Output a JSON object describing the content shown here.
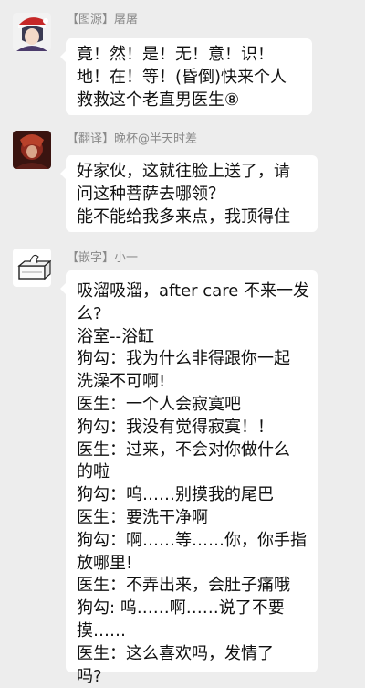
{
  "messages": [
    {
      "sender": "【图源】屠屠",
      "avatar_icon": "anime-boy-santa-hat-avatar",
      "lines": [
        "竟！然！是！无！意！识！",
        "地！在！等！(昏倒)快来个人",
        "救救这个老直男医生⑧"
      ]
    },
    {
      "sender": "【翻译】晚杯@半天时差",
      "avatar_icon": "dark-red-character-avatar",
      "lines": [
        "好家伙，这就往脸上送了，请",
        "问这种菩萨去哪领？",
        "能不能给我多来点，我顶得住"
      ]
    },
    {
      "sender": "【嵌字】小一",
      "avatar_icon": "tissue-box-avatar",
      "lines": [
        "吸溜吸溜，after care 不来一发",
        "么?",
        "浴室--浴缸",
        "狗勾：我为什么非得跟你一起",
        "洗澡不可啊!",
        "医生：一个人会寂寞吧",
        "狗勾：我没有觉得寂寞！！",
        "医生：过来，不会对你做什么",
        "的啦",
        "狗勾：呜……别摸我的尾巴",
        "医生：要洗干净啊",
        "狗勾：啊……等……你，你手指",
        "放哪里!",
        "医生：不弄出来，会肚子痛哦",
        "狗勾: 呜……啊……说了不要",
        "摸……",
        "医生：这么喜欢吗，发情了",
        "吗?"
      ]
    }
  ]
}
